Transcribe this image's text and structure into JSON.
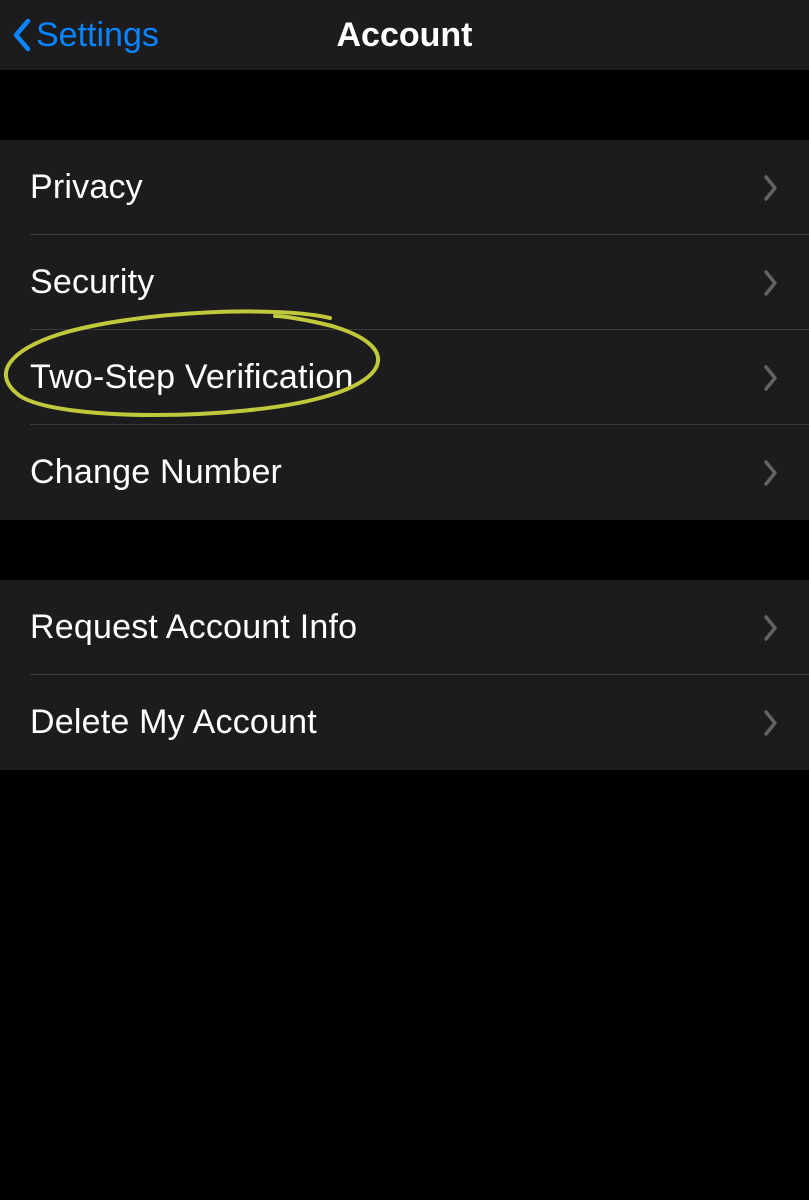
{
  "nav": {
    "back_label": "Settings",
    "title": "Account"
  },
  "groups": [
    {
      "rows": [
        {
          "label": "Privacy"
        },
        {
          "label": "Security"
        },
        {
          "label": "Two-Step Verification",
          "highlighted": true
        },
        {
          "label": "Change Number"
        }
      ]
    },
    {
      "rows": [
        {
          "label": "Request Account Info"
        },
        {
          "label": "Delete My Account"
        }
      ]
    }
  ],
  "annotation": {
    "stroke": "#c0c83b"
  }
}
